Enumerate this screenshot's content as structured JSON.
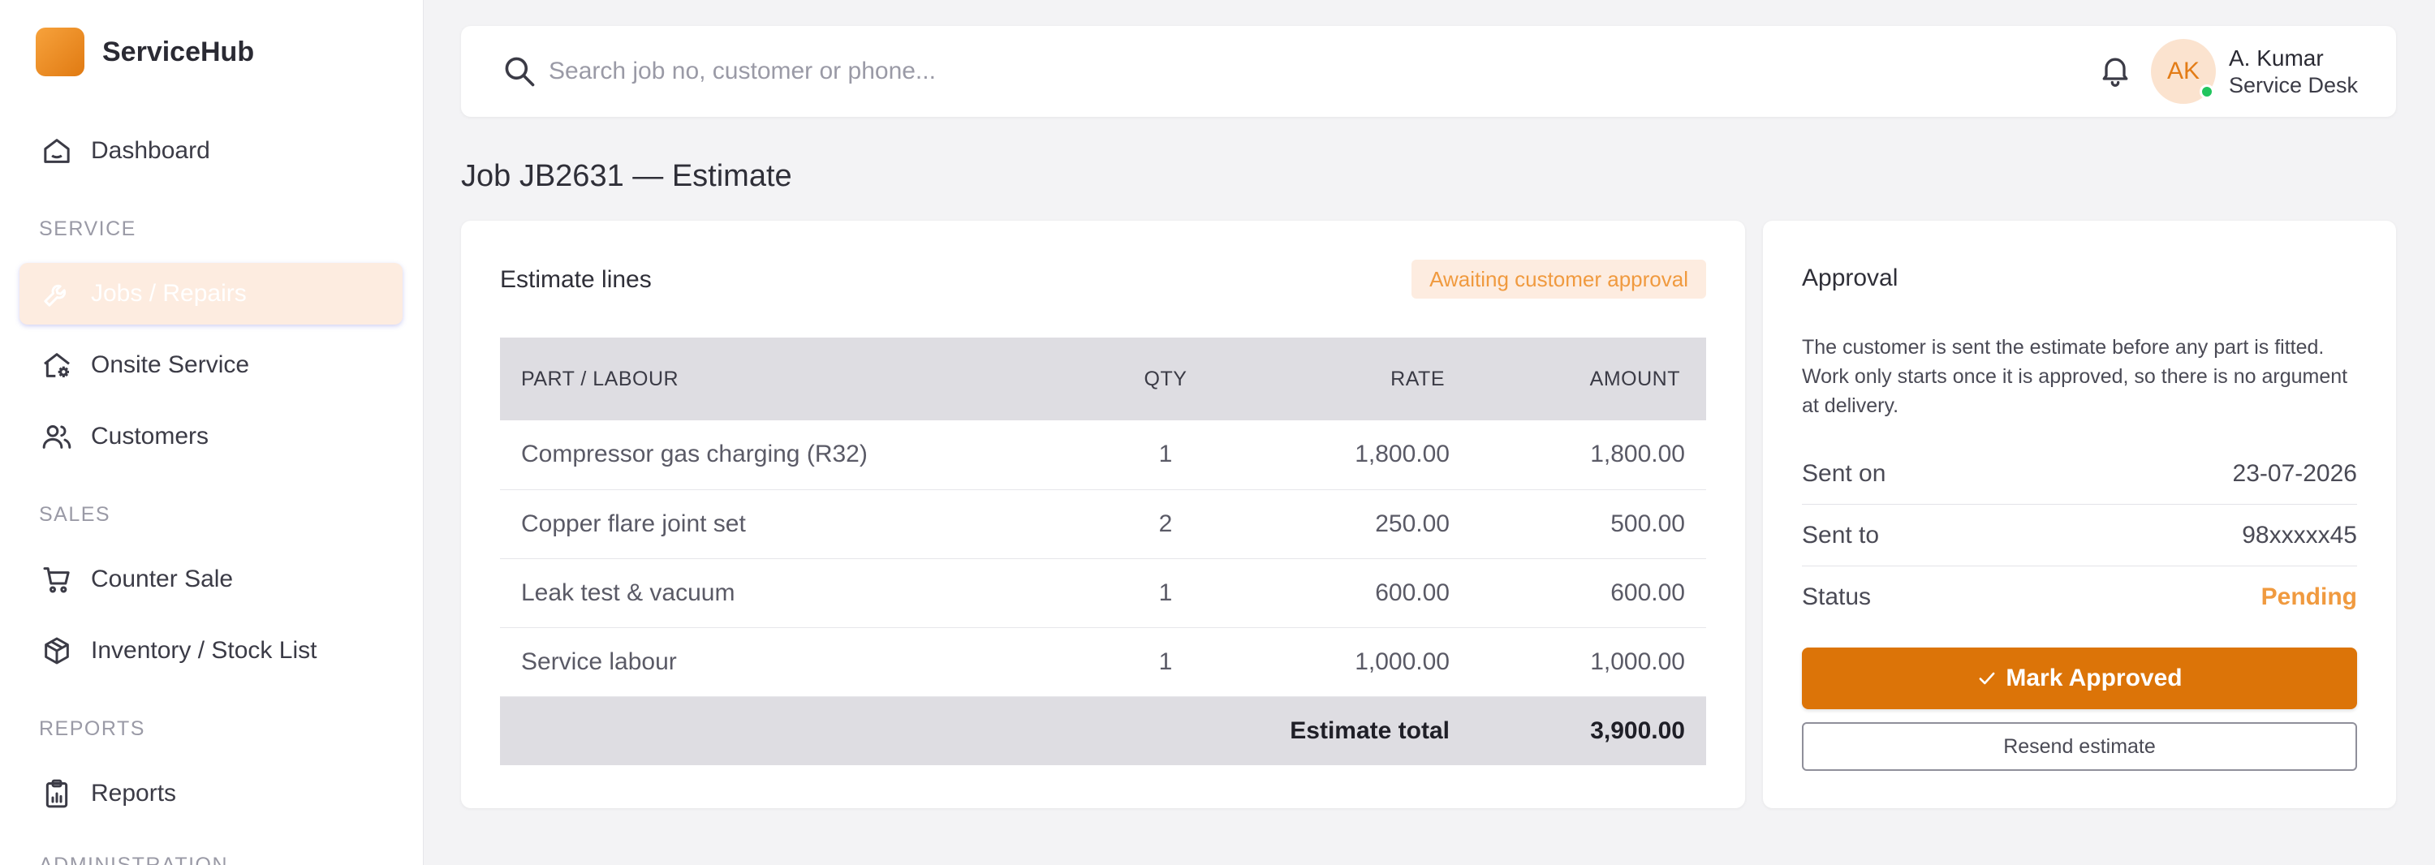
{
  "app": {
    "name": "ServiceHub"
  },
  "sidebar": {
    "items": [
      {
        "label": "Dashboard",
        "icon": "home-icon"
      },
      {
        "label": "Jobs / Repairs",
        "icon": "wrench-icon",
        "active": true
      },
      {
        "label": "Onsite Service",
        "icon": "house-gear-icon"
      },
      {
        "label": "Customers",
        "icon": "users-icon"
      },
      {
        "label": "Counter Sale",
        "icon": "cart-icon"
      },
      {
        "label": "Inventory / Stock List",
        "icon": "box-icon"
      },
      {
        "label": "Reports",
        "icon": "clipboard-chart-icon"
      }
    ],
    "sections": {
      "service": "SERVICE",
      "sales": "SALES",
      "reports": "REPORTS",
      "administration": "ADMINISTRATION"
    }
  },
  "header": {
    "search": {
      "placeholder": "Search job no, customer or phone...",
      "value": ""
    },
    "user": {
      "initials": "AK",
      "name": "A. Kumar",
      "role": "Service Desk",
      "online": true
    }
  },
  "page": {
    "title": "Job JB2631 — Estimate"
  },
  "estimate": {
    "title": "Estimate lines",
    "status": "Awaiting customer approval",
    "columns": {
      "part": "PART / LABOUR",
      "qty": "QTY",
      "rate": "RATE",
      "amount": "AMOUNT"
    },
    "rows": [
      {
        "part": "Compressor gas charging (R32)",
        "qty": "1",
        "rate": "1,800.00",
        "amount": "1,800.00"
      },
      {
        "part": "Copper flare joint set",
        "qty": "2",
        "rate": "250.00",
        "amount": "500.00"
      },
      {
        "part": "Leak test & vacuum",
        "qty": "1",
        "rate": "600.00",
        "amount": "600.00"
      },
      {
        "part": "Service labour",
        "qty": "1",
        "rate": "1,000.00",
        "amount": "1,000.00"
      }
    ],
    "total_label": "Estimate total",
    "total_value": "3,900.00"
  },
  "approval": {
    "title": "Approval",
    "description": "The customer is sent the estimate before any part is fitted. Work only starts once it is approved, so there is no argument at delivery.",
    "fields": [
      {
        "label": "Sent on",
        "value": "23-07-2026"
      },
      {
        "label": "Sent to",
        "value": "98xxxxx45"
      },
      {
        "label": "Status",
        "value": "Pending"
      }
    ],
    "approve_label": "Mark Approved",
    "resend_label": "Resend estimate"
  },
  "colors": {
    "accent": "#dc7408",
    "accent_soft": "#fdece0",
    "badge_text": "#f09a3f",
    "online": "#22c55e",
    "table_header": "#dedde2"
  }
}
